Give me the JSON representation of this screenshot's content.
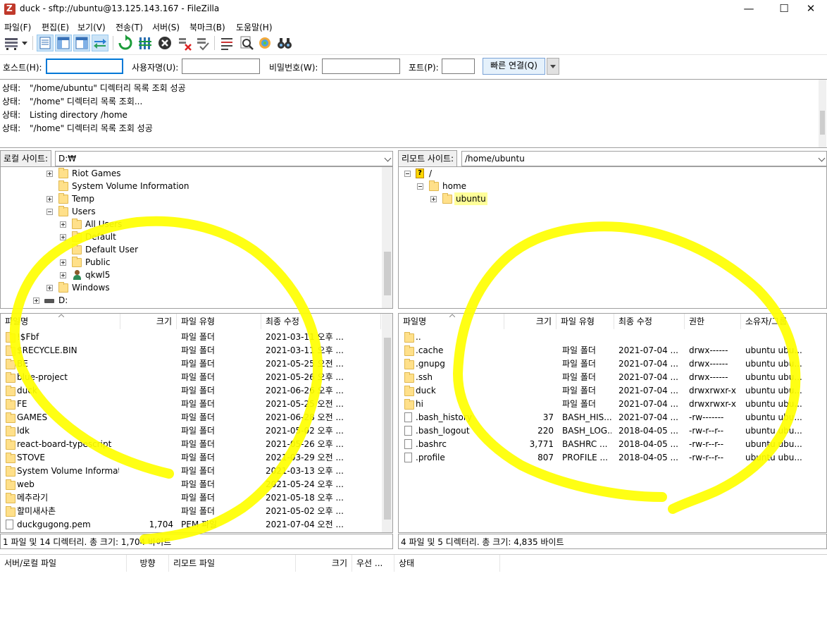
{
  "window": {
    "title": "duck - sftp://ubuntu@13.125.143.167 - FileZilla",
    "minimize": "—",
    "maximize": "☐",
    "close": "✕"
  },
  "menu": [
    "파일(F)",
    "편집(E)",
    "보기(V)",
    "전송(T)",
    "서버(S)",
    "북마크(B)",
    "도움말(H)"
  ],
  "toolbar": {
    "icons": [
      "site-manager-icon",
      "dropdown-arrow-icon",
      "toggle-log-icon",
      "toggle-local-tree-icon",
      "toggle-remote-tree-icon",
      "toggle-queue-icon",
      "refresh-icon",
      "process-queue-icon",
      "cancel-icon",
      "disconnect-icon",
      "reconnect-icon",
      "filter-icon",
      "search-icon",
      "compare-icon",
      "binoculars-icon"
    ]
  },
  "quickconnect": {
    "host_label": "호스트(H):",
    "host_value": "",
    "user_label": "사용자명(U):",
    "user_value": "",
    "pass_label": "비밀번호(W):",
    "pass_value": "",
    "port_label": "포트(P):",
    "port_value": "",
    "connect_button": "빠른 연결(Q)"
  },
  "log": [
    {
      "label": "상태:",
      "text": "\"/home/ubuntu\" 디렉터리 목록 조회 성공"
    },
    {
      "label": "상태:",
      "text": "\"/home\" 디렉터리 목록 조회..."
    },
    {
      "label": "상태:",
      "text": "Listing directory /home"
    },
    {
      "label": "상태:",
      "text": "\"/home\" 디렉터리 목록 조회 성공"
    }
  ],
  "local": {
    "site_label": "로컬 사이트:",
    "path": "D:₩",
    "tree": [
      {
        "name": "Riot Games"
      },
      {
        "name": "System Volume Information"
      },
      {
        "name": "Temp"
      },
      {
        "name": "Users"
      },
      {
        "name": "All Users"
      },
      {
        "name": "Default"
      },
      {
        "name": "Default User"
      },
      {
        "name": "Public"
      },
      {
        "name": "qkwl5"
      },
      {
        "name": "Windows"
      },
      {
        "name": "D:"
      }
    ],
    "columns": [
      "파일명",
      "크기",
      "파일 유형",
      "최종 수정"
    ],
    "files": [
      {
        "name": "!$Fbf",
        "size": "",
        "type": "파일 폴더",
        "modified": "2021-03-11 오후 ..."
      },
      {
        "name": "$RECYCLE.BIN",
        "size": "",
        "type": "파일 폴더",
        "modified": "2021-03-11 오후 ..."
      },
      {
        "name": "BE",
        "size": "",
        "type": "파일 폴더",
        "modified": "2021-05-25 오전 ..."
      },
      {
        "name": "blue-project",
        "size": "",
        "type": "파일 폴더",
        "modified": "2021-05-26 오후 ..."
      },
      {
        "name": "duck",
        "size": "",
        "type": "파일 폴더",
        "modified": "2021-06-26 오후 ..."
      },
      {
        "name": "FE",
        "size": "",
        "type": "파일 폴더",
        "modified": "2021-05-25 오전 ..."
      },
      {
        "name": "GAMES",
        "size": "",
        "type": "파일 폴더",
        "modified": "2021-06-28 오전 ..."
      },
      {
        "name": "ldk",
        "size": "",
        "type": "파일 폴더",
        "modified": "2021-05-02 오후 ..."
      },
      {
        "name": "react-board-typescript",
        "size": "",
        "type": "파일 폴더",
        "modified": "2021-05-26 오후 ..."
      },
      {
        "name": "STOVE",
        "size": "",
        "type": "파일 폴더",
        "modified": "2021-03-29 오전 ..."
      },
      {
        "name": "System Volume Informat...",
        "size": "",
        "type": "파일 폴더",
        "modified": "2021-03-13 오후 ..."
      },
      {
        "name": "web",
        "size": "",
        "type": "파일 폴더",
        "modified": "2021-05-24 오후 ..."
      },
      {
        "name": "메추라기",
        "size": "",
        "type": "파일 폴더",
        "modified": "2021-05-18 오후 ..."
      },
      {
        "name": "할미새사촌",
        "size": "",
        "type": "파일 폴더",
        "modified": "2021-05-02 오후 ..."
      },
      {
        "name": "duckgugong.pem",
        "size": "1,704",
        "type": "PEM 파일",
        "modified": "2021-07-04 오전 ..."
      }
    ],
    "status": "1 파일 및 14 디렉터리. 총 크기: 1,704 바이트"
  },
  "remote": {
    "site_label": "리모트 사이트:",
    "path": "/home/ubuntu",
    "tree": [
      {
        "name": "/"
      },
      {
        "name": "home"
      },
      {
        "name": "ubuntu"
      }
    ],
    "columns": [
      "파일명",
      "크기",
      "파일 유형",
      "최종 수정",
      "권한",
      "소유자/그룹"
    ],
    "files": [
      {
        "name": "..",
        "size": "",
        "type": "",
        "modified": "",
        "perm": "",
        "owner": ""
      },
      {
        "name": ".cache",
        "size": "",
        "type": "파일 폴더",
        "modified": "2021-07-04 ...",
        "perm": "drwx------",
        "owner": "ubuntu ubu..."
      },
      {
        "name": ".gnupg",
        "size": "",
        "type": "파일 폴더",
        "modified": "2021-07-04 ...",
        "perm": "drwx------",
        "owner": "ubuntu ubu..."
      },
      {
        "name": ".ssh",
        "size": "",
        "type": "파일 폴더",
        "modified": "2021-07-04 ...",
        "perm": "drwx------",
        "owner": "ubuntu ubu..."
      },
      {
        "name": "duck",
        "size": "",
        "type": "파일 폴더",
        "modified": "2021-07-04 ...",
        "perm": "drwxrwxr-x",
        "owner": "ubuntu ubu..."
      },
      {
        "name": "hi",
        "size": "",
        "type": "파일 폴더",
        "modified": "2021-07-04 ...",
        "perm": "drwxrwxr-x",
        "owner": "ubuntu ubu..."
      },
      {
        "name": ".bash_history",
        "size": "37",
        "type": "BASH_HIS...",
        "modified": "2021-07-04 ...",
        "perm": "-rw-------",
        "owner": "ubuntu ubu..."
      },
      {
        "name": ".bash_logout",
        "size": "220",
        "type": "BASH_LOG...",
        "modified": "2018-04-05 ...",
        "perm": "-rw-r--r--",
        "owner": "ubuntu ubu..."
      },
      {
        "name": ".bashrc",
        "size": "3,771",
        "type": "BASHRC ...",
        "modified": "2018-04-05 ...",
        "perm": "-rw-r--r--",
        "owner": "ubuntu ubu..."
      },
      {
        "name": ".profile",
        "size": "807",
        "type": "PROFILE ...",
        "modified": "2018-04-05 ...",
        "perm": "-rw-r--r--",
        "owner": "ubuntu ubu..."
      }
    ],
    "status": "4 파일 및 5 디렉터리. 총 크기: 4,835 바이트"
  },
  "queue": {
    "columns": [
      "서버/로컬 파일",
      "방향",
      "리모트 파일",
      "크기",
      "우선 ...",
      "상태"
    ]
  },
  "colors": {
    "highlight": "#ffff00",
    "accent": "#0078d7",
    "folder": "#ffe08a"
  }
}
